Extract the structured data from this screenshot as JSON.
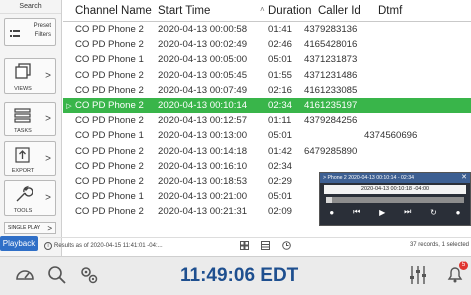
{
  "sidebar": {
    "header": "Search",
    "preset_label": "Preset Filters",
    "views_label": "VIEWS",
    "tasks_label": "TASKS",
    "export_label": "EXPORT",
    "tools_label": "TOOLS",
    "single_play_label": "SINGLE PLAY",
    "arrow": ">",
    "playback_label": "Playback"
  },
  "table": {
    "columns": [
      "Channel Name",
      "Start Time",
      "Duration",
      "Caller Id",
      "Dtmf"
    ],
    "sort_indicator": "˄",
    "selected_marker": "▷",
    "rows": [
      {
        "name": "CO PD Phone 2",
        "start": "2020-04-13 00:00:58",
        "duration": "01:41",
        "caller": "4379283136",
        "dtmf": ""
      },
      {
        "name": "CO PD Phone 2",
        "start": "2020-04-13 00:02:49",
        "duration": "02:46",
        "caller": "4165428016",
        "dtmf": ""
      },
      {
        "name": "CO PD Phone 1",
        "start": "2020-04-13 00:05:00",
        "duration": "05:01",
        "caller": "4371231873",
        "dtmf": ""
      },
      {
        "name": "CO PD Phone 2",
        "start": "2020-04-13 00:05:45",
        "duration": "01:55",
        "caller": "4371231486",
        "dtmf": ""
      },
      {
        "name": "CO PD Phone 2",
        "start": "2020-04-13 00:07:49",
        "duration": "02:16",
        "caller": "4161233085",
        "dtmf": ""
      },
      {
        "name": "CO PD Phone 2",
        "start": "2020-04-13 00:10:14",
        "duration": "02:34",
        "caller": "4161235197",
        "dtmf": "",
        "selected": true
      },
      {
        "name": "CO PD Phone 2",
        "start": "2020-04-13 00:12:57",
        "duration": "01:11",
        "caller": "4379284256",
        "dtmf": ""
      },
      {
        "name": "CO PD Phone 1",
        "start": "2020-04-13 00:13:00",
        "duration": "05:01",
        "caller": "",
        "dtmf": "4374560696"
      },
      {
        "name": "CO PD Phone 2",
        "start": "2020-04-13 00:14:18",
        "duration": "01:42",
        "caller": "6479285890",
        "dtmf": ""
      },
      {
        "name": "CO PD Phone 2",
        "start": "2020-04-13 00:16:10",
        "duration": "02:34",
        "caller": "",
        "dtmf": ""
      },
      {
        "name": "CO PD Phone 2",
        "start": "2020-04-13 00:18:53",
        "duration": "02:29",
        "caller": "",
        "dtmf": ""
      },
      {
        "name": "CO PD Phone 1",
        "start": "2020-04-13 00:21:00",
        "duration": "05:01",
        "caller": "",
        "dtmf": ""
      },
      {
        "name": "CO PD Phone 2",
        "start": "2020-04-13 00:21:31",
        "duration": "02:09",
        "caller": "",
        "dtmf": ""
      }
    ]
  },
  "status": {
    "results_text": "Results as of 2020-04-15 11:41:01 -04:...",
    "records_text": "37 records, 1 selected"
  },
  "player": {
    "title": "> Phone 2   2020-04-13 00:10:14 - 02:34",
    "time": "2020-04-13 00:10:18 -04:00",
    "close": "✕",
    "progress": 0.04
  },
  "bottom": {
    "clock": "11:49:06 EDT",
    "notification_count": "5"
  }
}
